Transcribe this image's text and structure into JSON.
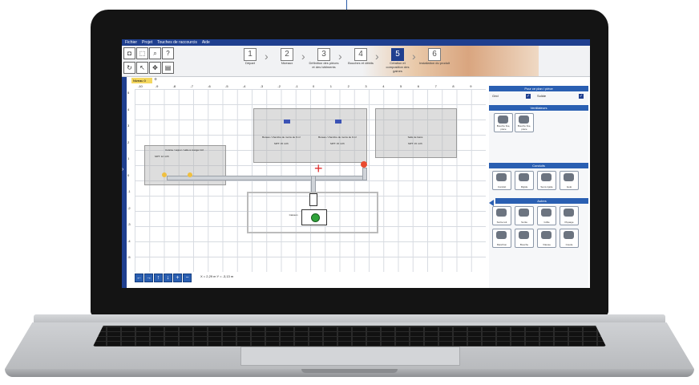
{
  "app": {
    "menu": [
      "Fichier",
      "Projet",
      "Touches de raccourcis",
      "Aide"
    ],
    "steps": [
      {
        "num": "1",
        "label": "Départ",
        "active": false
      },
      {
        "num": "2",
        "label": "Niveaux",
        "active": false
      },
      {
        "num": "3",
        "label": "Définition des pièces et des bâtiments",
        "active": false
      },
      {
        "num": "4",
        "label": "Bouches et débits",
        "active": false
      },
      {
        "num": "5",
        "label": "Création et composition des gaines",
        "active": true
      },
      {
        "num": "6",
        "label": "Installation du produit",
        "active": false
      }
    ],
    "level_tab": "Niveau 0",
    "add_tab": "+",
    "ruler_x": [
      "-10",
      "-9",
      "-8",
      "-7",
      "-6",
      "-5",
      "-4",
      "-3",
      "-2",
      "-1",
      "0",
      "1",
      "2",
      "3",
      "4",
      "5",
      "6",
      "7",
      "8",
      "9"
    ],
    "ruler_y": [
      "5",
      "4",
      "3",
      "2",
      "1",
      "0",
      "-1",
      "-2",
      "-3",
      "-4",
      "-5"
    ],
    "plan_labels": {
      "room_left": "Cuisine / séjour / salle à manger 1/2",
      "room_left_vals": "MPT: 12 m³/h",
      "room_mid1": "Bureau / chambre de moins de 9 m²",
      "room_mid1_vals": "MPT: 15 m³/h",
      "room_mid2": "Bureau / chambre de moins de 9 m²",
      "room_mid2_vals": "MPT: 15 m³/h",
      "room_right": "Salle de bains",
      "room_right_vals": "MPT: 15 m³/h",
      "unit_label": "Caisson"
    },
    "coords": "X = 2,29 m   Y = -3,13 m"
  },
  "panel": {
    "header_main": "Pour ce plan / pièce",
    "row_grid": "Grid",
    "row_solid": "Solide",
    "section_vent": "Ventilateurs",
    "vent_items": [
      "Bouche fixe, pièce",
      "Bouche fixe, pièce"
    ],
    "section_ducts": "Conduits",
    "duct_items": [
      "Conduit",
      "Rigide",
      "Semi-rigide",
      "Isolé"
    ],
    "section_other": "Autres",
    "other_items": [
      "Sortie toit",
      "Sortie",
      "Grille",
      "Piquage",
      "Manchon",
      "Bouche",
      "Vitesse",
      "Coude"
    ]
  },
  "colors": {
    "accent": "#1f3f8f",
    "panel_header": "#2a5fb2",
    "active_step": "#1f3f8f",
    "unit_green": "#2fa33a",
    "hood_red": "#e94a2f"
  }
}
